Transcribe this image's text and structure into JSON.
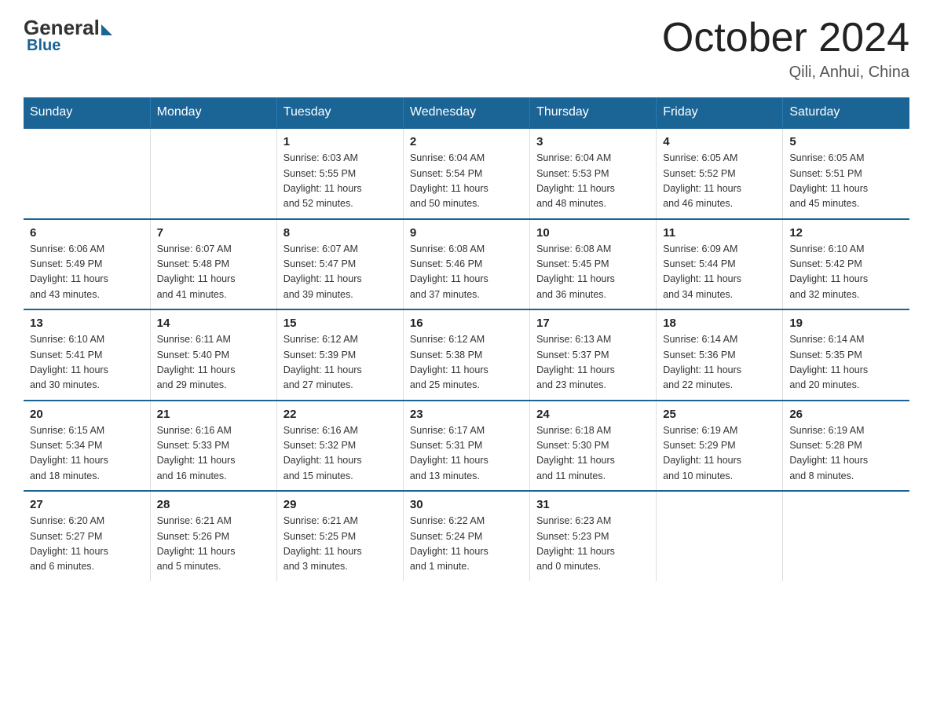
{
  "header": {
    "logo_general": "General",
    "logo_blue": "Blue",
    "main_title": "October 2024",
    "location": "Qili, Anhui, China"
  },
  "weekdays": [
    "Sunday",
    "Monday",
    "Tuesday",
    "Wednesday",
    "Thursday",
    "Friday",
    "Saturday"
  ],
  "weeks": [
    [
      {
        "day": "",
        "info": ""
      },
      {
        "day": "",
        "info": ""
      },
      {
        "day": "1",
        "info": "Sunrise: 6:03 AM\nSunset: 5:55 PM\nDaylight: 11 hours\nand 52 minutes."
      },
      {
        "day": "2",
        "info": "Sunrise: 6:04 AM\nSunset: 5:54 PM\nDaylight: 11 hours\nand 50 minutes."
      },
      {
        "day": "3",
        "info": "Sunrise: 6:04 AM\nSunset: 5:53 PM\nDaylight: 11 hours\nand 48 minutes."
      },
      {
        "day": "4",
        "info": "Sunrise: 6:05 AM\nSunset: 5:52 PM\nDaylight: 11 hours\nand 46 minutes."
      },
      {
        "day": "5",
        "info": "Sunrise: 6:05 AM\nSunset: 5:51 PM\nDaylight: 11 hours\nand 45 minutes."
      }
    ],
    [
      {
        "day": "6",
        "info": "Sunrise: 6:06 AM\nSunset: 5:49 PM\nDaylight: 11 hours\nand 43 minutes."
      },
      {
        "day": "7",
        "info": "Sunrise: 6:07 AM\nSunset: 5:48 PM\nDaylight: 11 hours\nand 41 minutes."
      },
      {
        "day": "8",
        "info": "Sunrise: 6:07 AM\nSunset: 5:47 PM\nDaylight: 11 hours\nand 39 minutes."
      },
      {
        "day": "9",
        "info": "Sunrise: 6:08 AM\nSunset: 5:46 PM\nDaylight: 11 hours\nand 37 minutes."
      },
      {
        "day": "10",
        "info": "Sunrise: 6:08 AM\nSunset: 5:45 PM\nDaylight: 11 hours\nand 36 minutes."
      },
      {
        "day": "11",
        "info": "Sunrise: 6:09 AM\nSunset: 5:44 PM\nDaylight: 11 hours\nand 34 minutes."
      },
      {
        "day": "12",
        "info": "Sunrise: 6:10 AM\nSunset: 5:42 PM\nDaylight: 11 hours\nand 32 minutes."
      }
    ],
    [
      {
        "day": "13",
        "info": "Sunrise: 6:10 AM\nSunset: 5:41 PM\nDaylight: 11 hours\nand 30 minutes."
      },
      {
        "day": "14",
        "info": "Sunrise: 6:11 AM\nSunset: 5:40 PM\nDaylight: 11 hours\nand 29 minutes."
      },
      {
        "day": "15",
        "info": "Sunrise: 6:12 AM\nSunset: 5:39 PM\nDaylight: 11 hours\nand 27 minutes."
      },
      {
        "day": "16",
        "info": "Sunrise: 6:12 AM\nSunset: 5:38 PM\nDaylight: 11 hours\nand 25 minutes."
      },
      {
        "day": "17",
        "info": "Sunrise: 6:13 AM\nSunset: 5:37 PM\nDaylight: 11 hours\nand 23 minutes."
      },
      {
        "day": "18",
        "info": "Sunrise: 6:14 AM\nSunset: 5:36 PM\nDaylight: 11 hours\nand 22 minutes."
      },
      {
        "day": "19",
        "info": "Sunrise: 6:14 AM\nSunset: 5:35 PM\nDaylight: 11 hours\nand 20 minutes."
      }
    ],
    [
      {
        "day": "20",
        "info": "Sunrise: 6:15 AM\nSunset: 5:34 PM\nDaylight: 11 hours\nand 18 minutes."
      },
      {
        "day": "21",
        "info": "Sunrise: 6:16 AM\nSunset: 5:33 PM\nDaylight: 11 hours\nand 16 minutes."
      },
      {
        "day": "22",
        "info": "Sunrise: 6:16 AM\nSunset: 5:32 PM\nDaylight: 11 hours\nand 15 minutes."
      },
      {
        "day": "23",
        "info": "Sunrise: 6:17 AM\nSunset: 5:31 PM\nDaylight: 11 hours\nand 13 minutes."
      },
      {
        "day": "24",
        "info": "Sunrise: 6:18 AM\nSunset: 5:30 PM\nDaylight: 11 hours\nand 11 minutes."
      },
      {
        "day": "25",
        "info": "Sunrise: 6:19 AM\nSunset: 5:29 PM\nDaylight: 11 hours\nand 10 minutes."
      },
      {
        "day": "26",
        "info": "Sunrise: 6:19 AM\nSunset: 5:28 PM\nDaylight: 11 hours\nand 8 minutes."
      }
    ],
    [
      {
        "day": "27",
        "info": "Sunrise: 6:20 AM\nSunset: 5:27 PM\nDaylight: 11 hours\nand 6 minutes."
      },
      {
        "day": "28",
        "info": "Sunrise: 6:21 AM\nSunset: 5:26 PM\nDaylight: 11 hours\nand 5 minutes."
      },
      {
        "day": "29",
        "info": "Sunrise: 6:21 AM\nSunset: 5:25 PM\nDaylight: 11 hours\nand 3 minutes."
      },
      {
        "day": "30",
        "info": "Sunrise: 6:22 AM\nSunset: 5:24 PM\nDaylight: 11 hours\nand 1 minute."
      },
      {
        "day": "31",
        "info": "Sunrise: 6:23 AM\nSunset: 5:23 PM\nDaylight: 11 hours\nand 0 minutes."
      },
      {
        "day": "",
        "info": ""
      },
      {
        "day": "",
        "info": ""
      }
    ]
  ]
}
